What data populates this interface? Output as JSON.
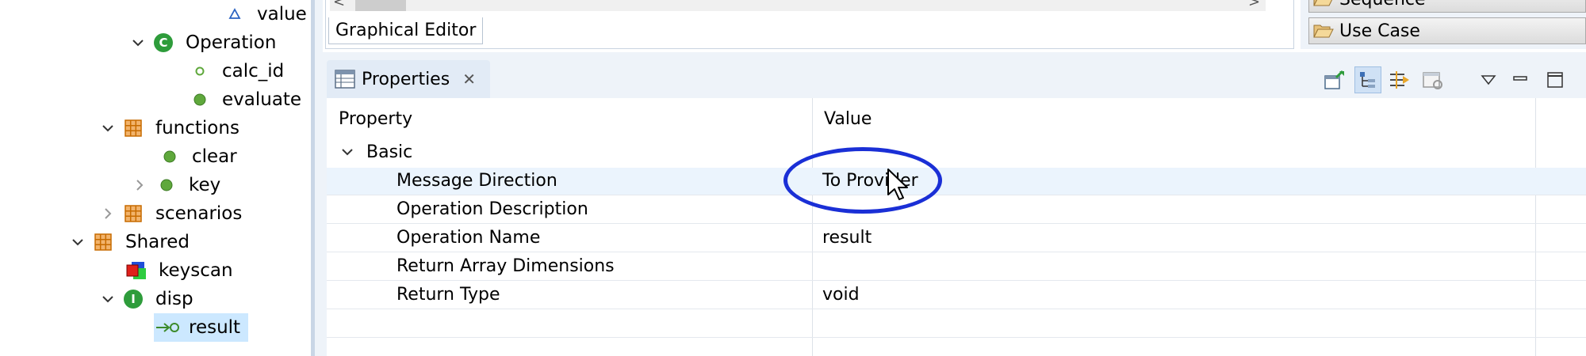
{
  "tree": {
    "items": [
      {
        "label": "value",
        "icon": "attribute-icon"
      },
      {
        "label": "Operation",
        "icon": "class-icon",
        "badge": "C"
      },
      {
        "label": "calc_id",
        "icon": "attribute-icon"
      },
      {
        "label": "evaluate",
        "icon": "operation-icon"
      },
      {
        "label": "functions",
        "icon": "package-icon"
      },
      {
        "label": "clear",
        "icon": "operation-icon"
      },
      {
        "label": "key",
        "icon": "operation-icon"
      },
      {
        "label": "scenarios",
        "icon": "package-icon"
      },
      {
        "label": "Shared",
        "icon": "package-icon"
      },
      {
        "label": "keyscan",
        "icon": "component-icon"
      },
      {
        "label": "disp",
        "icon": "interface-icon",
        "badge": "I"
      },
      {
        "label": "result",
        "icon": "port-icon"
      }
    ]
  },
  "editor": {
    "tab_label": "Graphical Editor",
    "scroll_left": "<",
    "scroll_right": ">"
  },
  "palette": {
    "items": [
      {
        "label": "Sequence"
      },
      {
        "label": "Use Case"
      }
    ]
  },
  "properties": {
    "tab_label": "Properties",
    "close_glyph": "✕",
    "columns": {
      "property": "Property",
      "value": "Value"
    },
    "group": "Basic",
    "rows": [
      {
        "name": "Message Direction",
        "value": "To Provider"
      },
      {
        "name": "Operation Description",
        "value": ""
      },
      {
        "name": "Operation Name",
        "value": "result"
      },
      {
        "name": "Return Array Dimensions",
        "value": ""
      },
      {
        "name": "Return Type",
        "value": "void"
      }
    ]
  },
  "colors": {
    "accent": "#1a2fd6",
    "selection": "#cce8ff",
    "package": "#c76b00",
    "operation": "#5fa83c",
    "class": "#2e9c3b"
  }
}
